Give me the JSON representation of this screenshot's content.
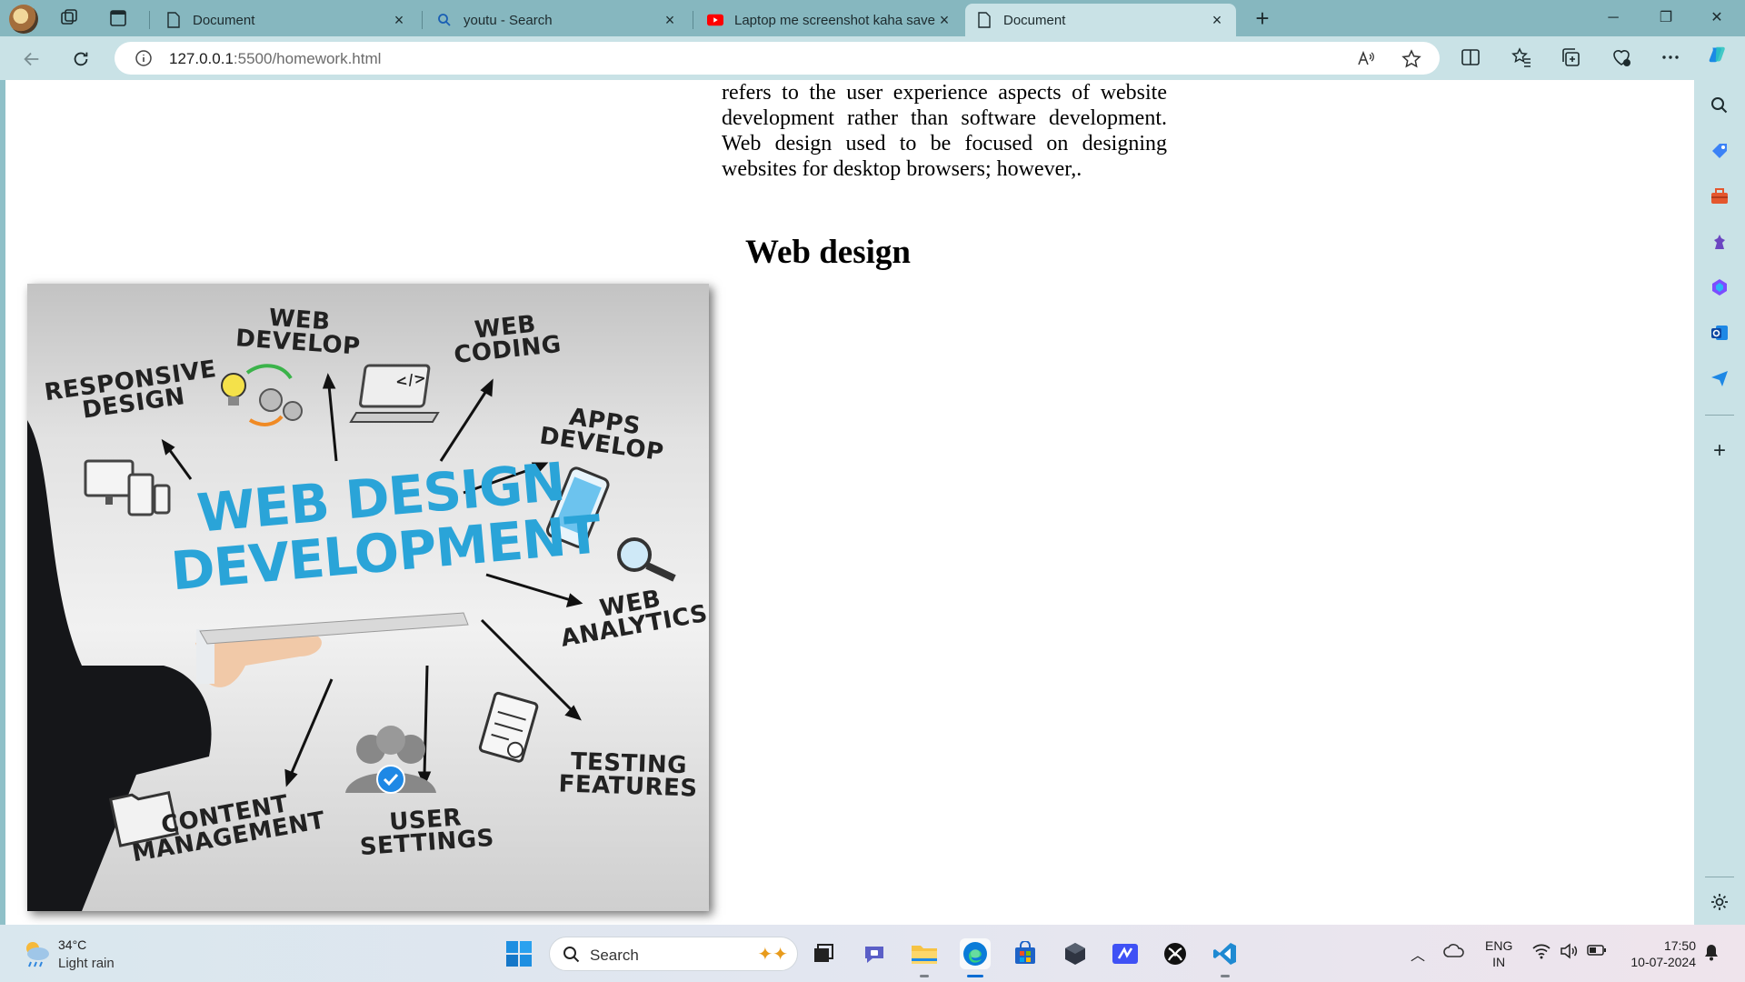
{
  "browser": {
    "tabs": [
      {
        "title": "Document",
        "icon": "page-icon",
        "active": false
      },
      {
        "title": "youtu - Search",
        "icon": "search-icon",
        "active": false
      },
      {
        "title": "Laptop me screenshot kaha save",
        "icon": "youtube-icon",
        "active": false
      },
      {
        "title": "Document",
        "icon": "page-icon",
        "active": true
      }
    ],
    "address": {
      "host": "127.0.0.1",
      "rest": ":5500/homework.html"
    },
    "colors": {
      "tabstrip": "#86b7bf",
      "toolbar": "#c9e2e6",
      "active_tab": "#c9e2e6"
    }
  },
  "page": {
    "paragraph": "refers to the user experience aspects of website development rather than software development. Web design used to be focused on designing websites for desktop browsers; however,.",
    "heading": "Web design",
    "image": {
      "title_line1": "WEB DESIGN",
      "title_line2": "DEVELOPMENT",
      "labels": {
        "responsive1": "RESPONSIVE",
        "responsive2": "DESIGN",
        "develop1": "WEB",
        "develop2": "DEVELOP",
        "coding1": "WEB",
        "coding2": "CODING",
        "apps1": "APPS",
        "apps2": "DEVELOP",
        "analytics1": "WEB",
        "analytics2": "ANALYTICS",
        "testing1": "TESTING",
        "testing2": "FEATURES",
        "content1": "CONTENT",
        "content2": "MANAGEMENT",
        "settings1": "USER",
        "settings2": "SETTINGS",
        "code_glyph": "</>"
      },
      "accent": "#2aa4d8"
    }
  },
  "taskbar": {
    "weather": {
      "temp": "34°C",
      "desc": "Light rain"
    },
    "search_label": "Search",
    "lang_line1": "ENG",
    "lang_line2": "IN",
    "time": "17:50",
    "date": "10-07-2024"
  }
}
